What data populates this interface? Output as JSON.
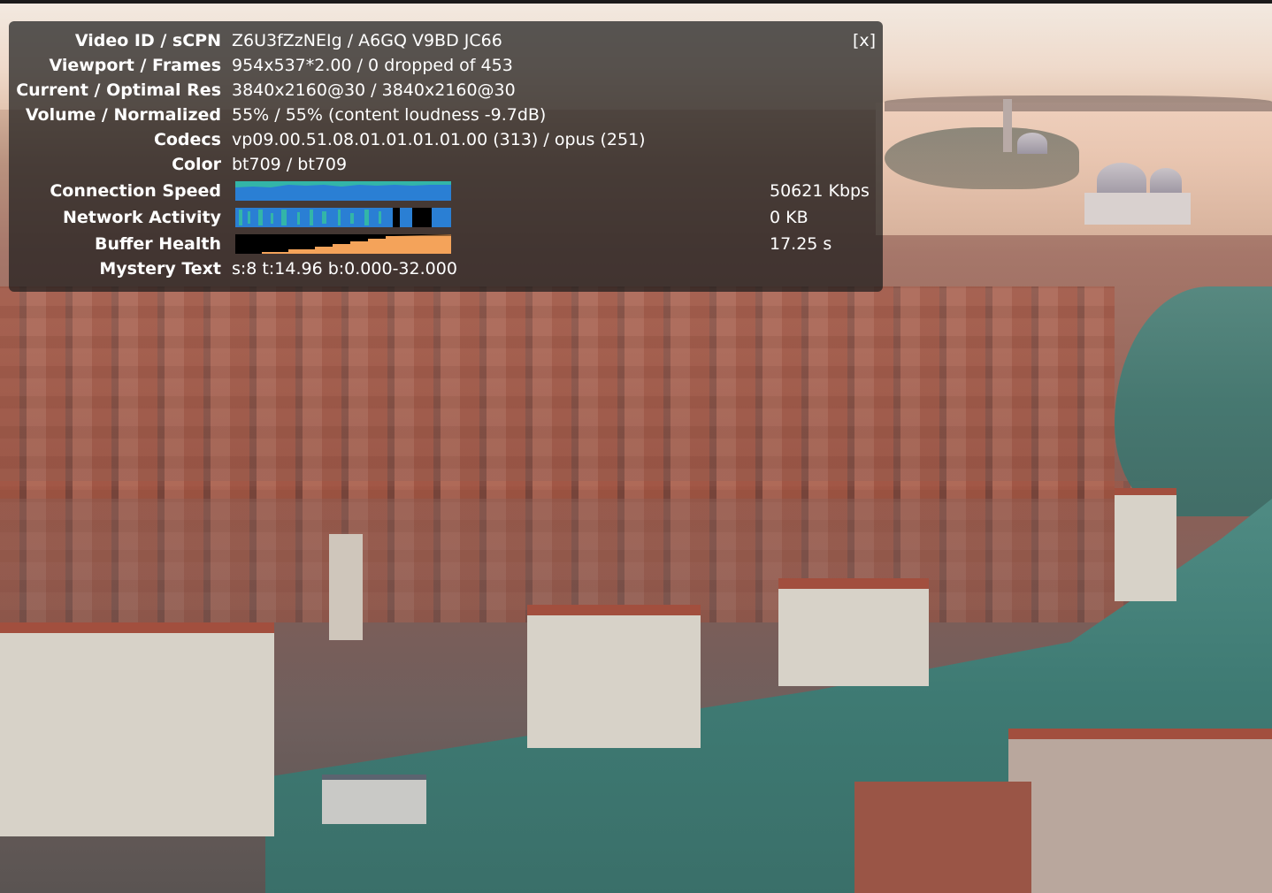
{
  "stats": {
    "close_label": "[x]",
    "rows": [
      {
        "label": "Video ID / sCPN",
        "value": "Z6U3fZzNEIg / A6GQ V9BD JC66"
      },
      {
        "label": "Viewport / Frames",
        "value": "954x537*2.00 / 0 dropped of 453"
      },
      {
        "label": "Current / Optimal Res",
        "value": "3840x2160@30 / 3840x2160@30"
      },
      {
        "label": "Volume / Normalized",
        "value": "55% / 55% (content loudness -9.7dB)"
      },
      {
        "label": "Codecs",
        "value": "vp09.00.51.08.01.01.01.01.00 (313) / opus (251)"
      },
      {
        "label": "Color",
        "value": "bt709 / bt709"
      }
    ],
    "graphs": [
      {
        "label": "Connection Speed",
        "value": "50621 Kbps",
        "colors": [
          "#2a7fd4",
          "#33b5a8"
        ]
      },
      {
        "label": "Network Activity",
        "value": "0 KB",
        "colors": [
          "#2a7fd4",
          "#33b5a8",
          "#000000"
        ]
      },
      {
        "label": "Buffer Health",
        "value": "17.25 s",
        "colors": [
          "#000000",
          "#f4a35a"
        ]
      }
    ],
    "mystery": {
      "label": "Mystery Text",
      "value": "s:8 t:14.96 b:0.000-32.000"
    }
  }
}
